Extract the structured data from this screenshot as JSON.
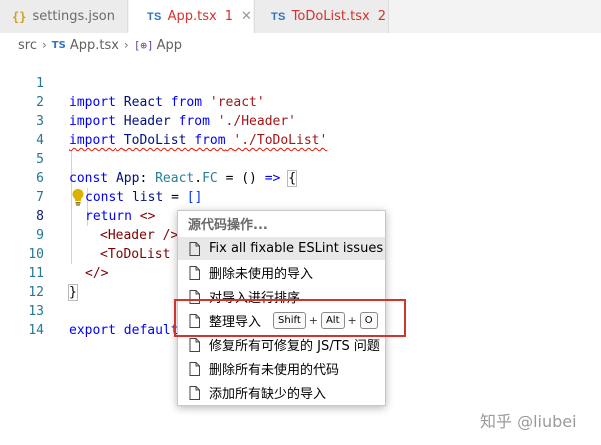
{
  "tabs": [
    {
      "icon": "{}",
      "label": "settings.json",
      "count": ""
    },
    {
      "icon": "TS",
      "label": "App.tsx",
      "count": "1"
    },
    {
      "icon": "TS",
      "label": "ToDoList.tsx",
      "count": "2"
    }
  ],
  "breadcrumb": {
    "folder": "src",
    "file_icon": "TS",
    "file": "App.tsx",
    "symbol_icon": "[⊕]",
    "symbol": "App"
  },
  "line_numbers": [
    "1",
    "2",
    "3",
    "4",
    "5",
    "6",
    "7",
    "8",
    "9",
    "10",
    "11",
    "12",
    "13",
    "14"
  ],
  "code": {
    "l1": [
      "import",
      "React",
      "from",
      "'react'"
    ],
    "l2": [
      "import",
      "Header",
      "from",
      "'./Header'"
    ],
    "l3": [
      "import",
      "ToDoList",
      "from",
      "'./ToDoList'"
    ],
    "l5": [
      "const",
      "App",
      ":",
      "React",
      ".",
      "FC",
      "=",
      "()",
      "=>",
      "{"
    ],
    "l6": [
      "const",
      "list",
      "=",
      "[]"
    ],
    "l7": [
      "return",
      "<>"
    ],
    "l8": [
      "<",
      "Header",
      "/>"
    ],
    "l9": [
      "<",
      "ToDoList"
    ],
    "l10": [
      "</>"
    ],
    "l11": [
      "}"
    ],
    "l13": [
      "export",
      "default"
    ]
  },
  "menu": {
    "title": "源代码操作...",
    "items": [
      {
        "label": "Fix all fixable ESLint issues"
      },
      {
        "label": "删除未使用的导入"
      },
      {
        "label": "对导入进行排序"
      },
      {
        "label": "整理导入"
      },
      {
        "label": "修复所有可修复的 JS/TS 问题"
      },
      {
        "label": "删除所有未使用的代码"
      },
      {
        "label": "添加所有缺少的导入"
      }
    ],
    "shortcut": {
      "key1": "Shift",
      "key2": "Alt",
      "key3": "O",
      "plus": "+"
    }
  },
  "watermark": "知乎 @liubei",
  "colors": {
    "highlight_box": "#d0342c",
    "keyword": "#0000ff",
    "string": "#a31515"
  }
}
